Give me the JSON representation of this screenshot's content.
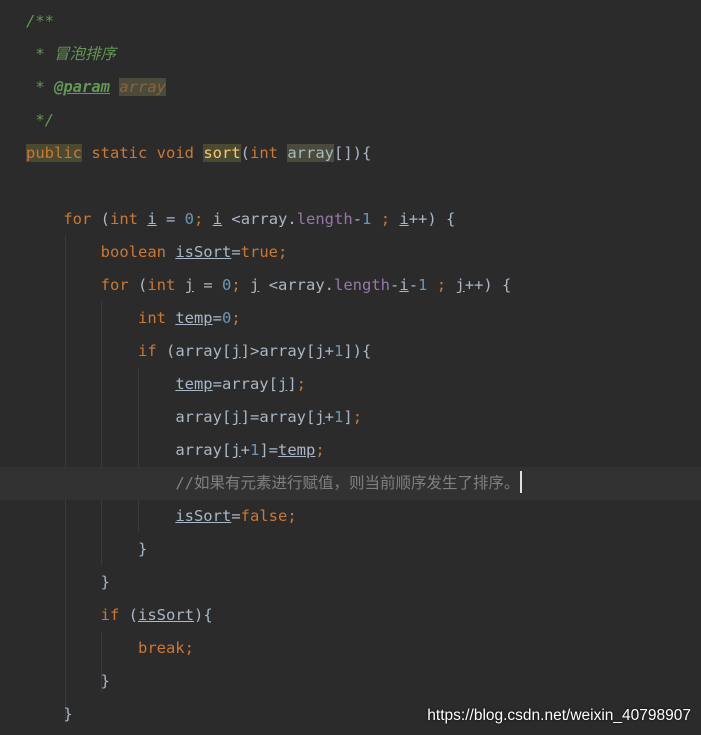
{
  "watermark": "https://blog.csdn.net/weixin_40798907",
  "lines": [
    [
      {
        "t": "/**",
        "c": "doc"
      }
    ],
    [
      {
        "t": " * 冒泡排序",
        "c": "doc"
      }
    ],
    [
      {
        "t": " * ",
        "c": "doc"
      },
      {
        "t": "@param",
        "c": "tag"
      },
      {
        "t": " ",
        "c": "doc"
      },
      {
        "t": "array",
        "c": "param hl-arr"
      }
    ],
    [
      {
        "t": " */",
        "c": "doc"
      }
    ],
    [
      {
        "t": "public",
        "c": "kw hl"
      },
      {
        "t": " static void ",
        "c": "kw"
      },
      {
        "t": "sort",
        "c": "fn hl"
      },
      {
        "t": "(",
        "c": "plain"
      },
      {
        "t": "int ",
        "c": "kw"
      },
      {
        "t": "array",
        "c": "plain hl-arr"
      },
      {
        "t": "[]){",
        "c": "plain"
      }
    ],
    [],
    [
      {
        "t": "    ",
        "c": "plain"
      },
      {
        "t": "for ",
        "c": "kw"
      },
      {
        "t": "(",
        "c": "plain"
      },
      {
        "t": "int ",
        "c": "kw"
      },
      {
        "t": "i",
        "c": "var"
      },
      {
        "t": " = ",
        "c": "plain"
      },
      {
        "t": "0",
        "c": "num"
      },
      {
        "t": "; ",
        "c": "kw"
      },
      {
        "t": "i",
        "c": "var"
      },
      {
        "t": " <array.",
        "c": "plain"
      },
      {
        "t": "length",
        "c": "field"
      },
      {
        "t": "-",
        "c": "plain"
      },
      {
        "t": "1",
        "c": "num"
      },
      {
        "t": " ; ",
        "c": "kw"
      },
      {
        "t": "i",
        "c": "var"
      },
      {
        "t": "++) {",
        "c": "plain"
      }
    ],
    [
      {
        "t": "        ",
        "c": "plain"
      },
      {
        "t": "boolean ",
        "c": "kw"
      },
      {
        "t": "isSort",
        "c": "var"
      },
      {
        "t": "=",
        "c": "plain"
      },
      {
        "t": "true",
        "c": "kw"
      },
      {
        "t": ";",
        "c": "kw"
      }
    ],
    [
      {
        "t": "        ",
        "c": "plain"
      },
      {
        "t": "for ",
        "c": "kw"
      },
      {
        "t": "(",
        "c": "plain"
      },
      {
        "t": "int ",
        "c": "kw"
      },
      {
        "t": "j",
        "c": "var"
      },
      {
        "t": " = ",
        "c": "plain"
      },
      {
        "t": "0",
        "c": "num"
      },
      {
        "t": "; ",
        "c": "kw"
      },
      {
        "t": "j",
        "c": "var"
      },
      {
        "t": " <array.",
        "c": "plain"
      },
      {
        "t": "length",
        "c": "field"
      },
      {
        "t": "-",
        "c": "plain"
      },
      {
        "t": "i",
        "c": "var"
      },
      {
        "t": "-",
        "c": "plain"
      },
      {
        "t": "1",
        "c": "num"
      },
      {
        "t": " ; ",
        "c": "kw"
      },
      {
        "t": "j",
        "c": "var"
      },
      {
        "t": "++) {",
        "c": "plain"
      }
    ],
    [
      {
        "t": "            ",
        "c": "plain"
      },
      {
        "t": "int ",
        "c": "kw"
      },
      {
        "t": "temp",
        "c": "var"
      },
      {
        "t": "=",
        "c": "plain"
      },
      {
        "t": "0",
        "c": "num"
      },
      {
        "t": ";",
        "c": "kw"
      }
    ],
    [
      {
        "t": "            ",
        "c": "plain"
      },
      {
        "t": "if ",
        "c": "kw"
      },
      {
        "t": "(array[",
        "c": "plain"
      },
      {
        "t": "j",
        "c": "var"
      },
      {
        "t": "]>array[",
        "c": "plain"
      },
      {
        "t": "j",
        "c": "var"
      },
      {
        "t": "+",
        "c": "plain"
      },
      {
        "t": "1",
        "c": "num"
      },
      {
        "t": "]){",
        "c": "plain"
      }
    ],
    [
      {
        "t": "                ",
        "c": "plain"
      },
      {
        "t": "temp",
        "c": "var"
      },
      {
        "t": "=array[",
        "c": "plain"
      },
      {
        "t": "j",
        "c": "var"
      },
      {
        "t": "]",
        "c": "plain"
      },
      {
        "t": ";",
        "c": "kw"
      }
    ],
    [
      {
        "t": "                ",
        "c": "plain"
      },
      {
        "t": "array[",
        "c": "plain"
      },
      {
        "t": "j",
        "c": "var"
      },
      {
        "t": "]=array[",
        "c": "plain"
      },
      {
        "t": "j",
        "c": "var"
      },
      {
        "t": "+",
        "c": "plain"
      },
      {
        "t": "1",
        "c": "num"
      },
      {
        "t": "]",
        "c": "plain"
      },
      {
        "t": ";",
        "c": "kw"
      }
    ],
    [
      {
        "t": "                ",
        "c": "plain"
      },
      {
        "t": "array[",
        "c": "plain"
      },
      {
        "t": "j",
        "c": "var"
      },
      {
        "t": "+",
        "c": "plain"
      },
      {
        "t": "1",
        "c": "num"
      },
      {
        "t": "]=",
        "c": "plain"
      },
      {
        "t": "temp",
        "c": "var"
      },
      {
        "t": ";",
        "c": "kw"
      }
    ],
    [
      {
        "t": "                ",
        "c": "plain"
      },
      {
        "t": "//如果有元素进行赋值，则当前顺序发生了排序。",
        "c": "comment"
      }
    ],
    [
      {
        "t": "                ",
        "c": "plain"
      },
      {
        "t": "isSort",
        "c": "var"
      },
      {
        "t": "=",
        "c": "plain"
      },
      {
        "t": "false",
        "c": "kw"
      },
      {
        "t": ";",
        "c": "kw"
      }
    ],
    [
      {
        "t": "            }",
        "c": "plain"
      }
    ],
    [
      {
        "t": "        }",
        "c": "plain"
      }
    ],
    [
      {
        "t": "        ",
        "c": "plain"
      },
      {
        "t": "if ",
        "c": "kw"
      },
      {
        "t": "(",
        "c": "plain"
      },
      {
        "t": "isSort",
        "c": "var"
      },
      {
        "t": "){",
        "c": "plain"
      }
    ],
    [
      {
        "t": "            ",
        "c": "plain"
      },
      {
        "t": "break",
        "c": "kw"
      },
      {
        "t": ";",
        "c": "kw"
      }
    ],
    [
      {
        "t": "        }",
        "c": "plain"
      }
    ],
    [
      {
        "t": "    }",
        "c": "plain"
      }
    ]
  ]
}
